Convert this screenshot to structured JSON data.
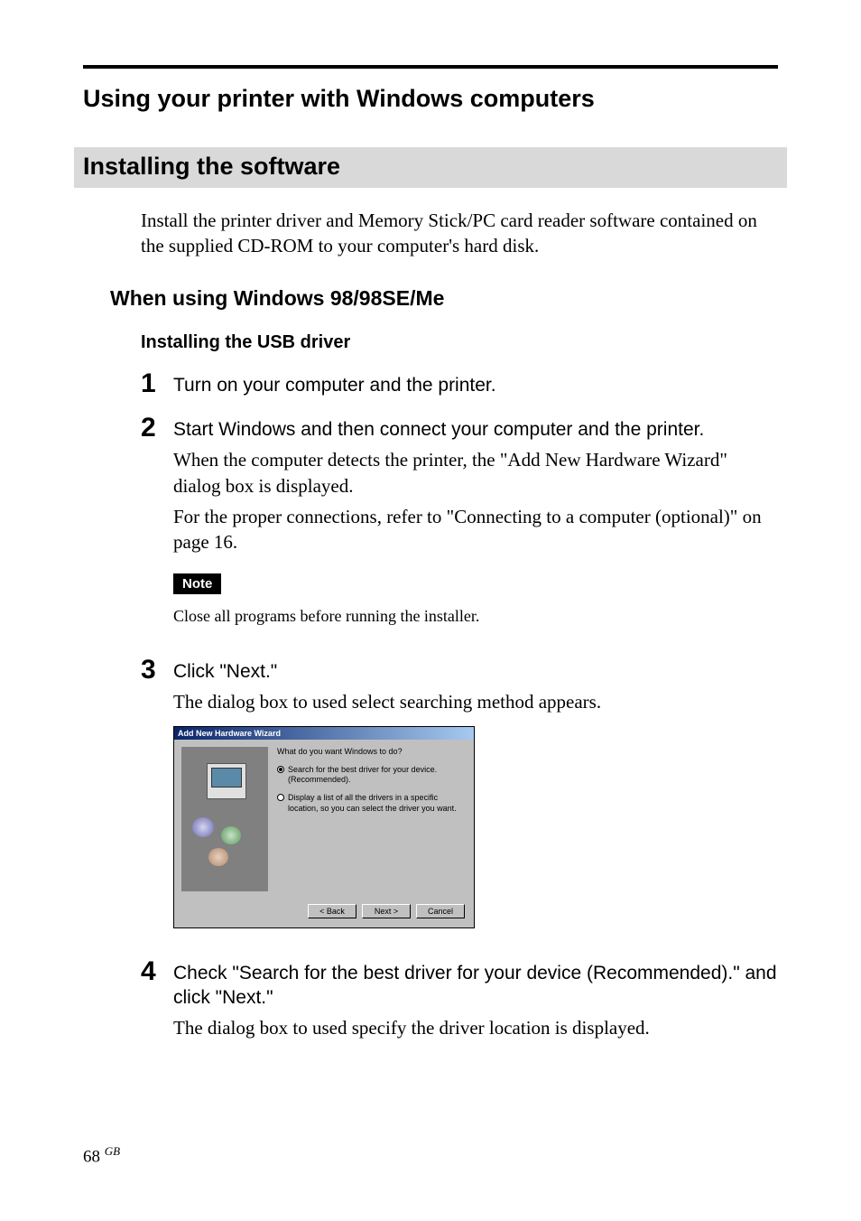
{
  "heading": "Using your printer with Windows computers",
  "section_title": "Installing the software",
  "intro": "Install the printer driver and Memory Stick/PC card reader software contained on the supplied CD-ROM to your computer's hard disk.",
  "sub_heading": "When using Windows 98/98SE/Me",
  "sub_heading2": "Installing the USB driver",
  "steps": [
    {
      "num": "1",
      "instruction": "Turn on your computer and the printer."
    },
    {
      "num": "2",
      "instruction": "Start Windows and then connect your computer and the printer.",
      "detail1": "When the computer detects the printer, the \"Add New Hardware Wizard\" dialog box is displayed.",
      "detail2": "For the proper connections, refer to \"Connecting to a computer (optional)\" on page 16.",
      "note_label": "Note",
      "note_text": "Close all programs before running the installer."
    },
    {
      "num": "3",
      "instruction": "Click \"Next.\"",
      "detail1": "The dialog box to used select searching method appears."
    },
    {
      "num": "4",
      "instruction": "Check \"Search for the best driver for your device (Recommended).\" and click \"Next.\"",
      "detail1": "The dialog box to used specify the driver location is displayed."
    }
  ],
  "dialog": {
    "title": "Add New Hardware Wizard",
    "question": "What do you want Windows to do?",
    "option1": "Search for the best driver for your device. (Recommended).",
    "option2": "Display a list of all the drivers in a specific location, so you can select the driver you want.",
    "back": "< Back",
    "next": "Next >",
    "cancel": "Cancel"
  },
  "page_number": "68",
  "page_suffix": "GB"
}
